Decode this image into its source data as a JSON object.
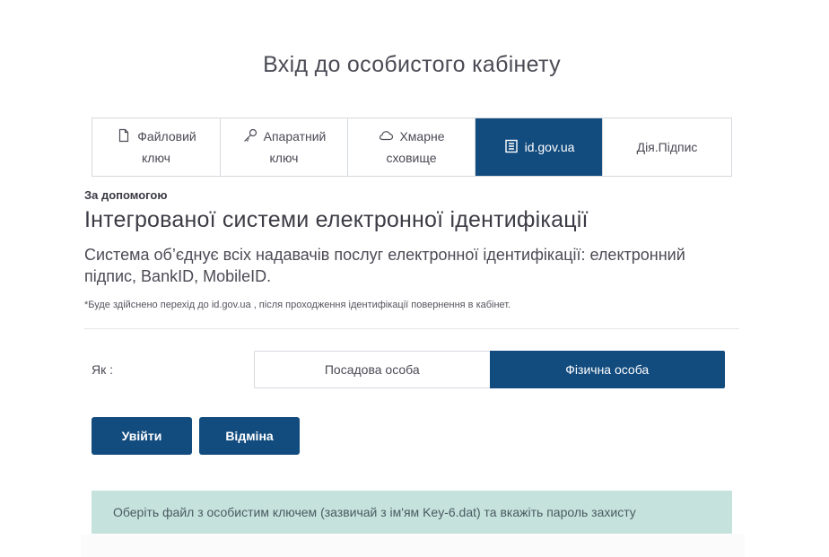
{
  "page": {
    "title": "Вхід до особистого кабінету"
  },
  "tabs": [
    {
      "line1": "Файловий",
      "line2": "ключ",
      "icon": "file-icon",
      "active": false
    },
    {
      "line1": "Апаратний",
      "line2": "ключ",
      "icon": "key-icon",
      "active": false
    },
    {
      "line1": "Хмарне",
      "line2": "сховище",
      "icon": "cloud-icon",
      "active": false
    },
    {
      "line1": "id.gov.ua",
      "line2": "",
      "icon": "document-icon",
      "active": true
    },
    {
      "line1": "Дія.Підпис",
      "line2": "",
      "icon": "",
      "active": false
    }
  ],
  "content": {
    "subtitle": "За допомогою",
    "heading": "Інтегрованої системи електронної ідентифікації",
    "description": "Система об’єднує всіх надавачів послуг електронної ідентифікації: електронний підпис, BankID, MobileID.",
    "note": "*Буде здійснено перехід до id.gov.ua , після проходження ідентифікації повернення в кабінет."
  },
  "role": {
    "label": "Як :",
    "options": [
      "Посадова особа",
      "Фізична особа"
    ],
    "selected": "Фізична особа"
  },
  "actions": {
    "login_label": "Увійти",
    "cancel_label": "Відміна"
  },
  "info": {
    "message": "Оберіть файл з особистим ключем (зазвичай з ім'ям Key-6.dat) та вкажіть пароль захисту"
  },
  "colors": {
    "primary": "#124b7e",
    "info_bg": "#c5e2dd",
    "border": "#d6d9de"
  }
}
